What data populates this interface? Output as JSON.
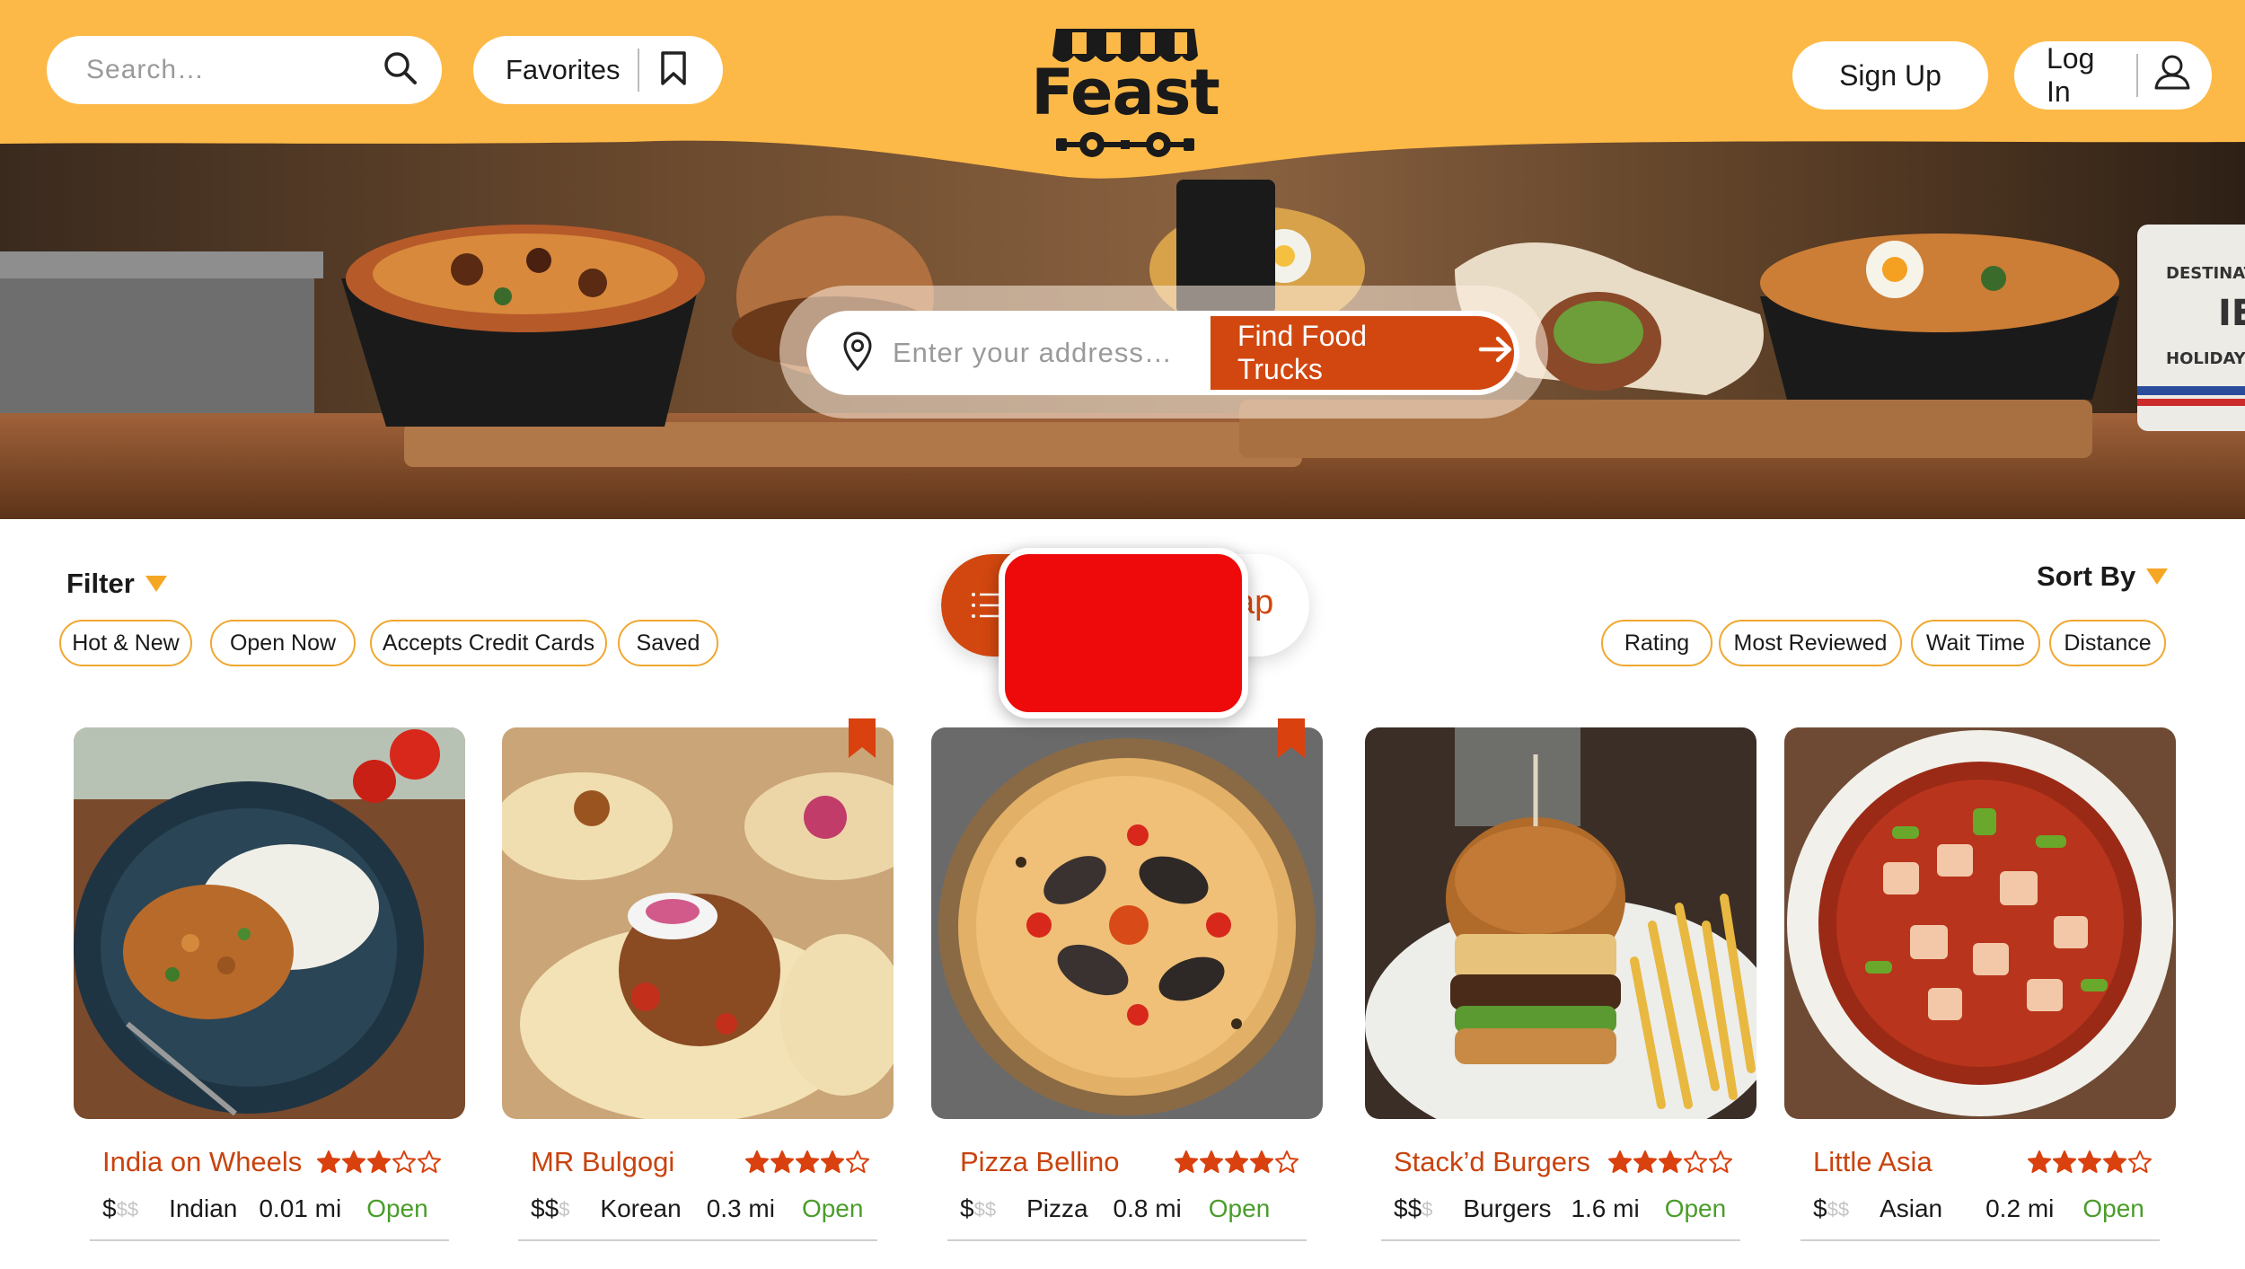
{
  "header": {
    "search_placeholder": "Search…",
    "favorites_label": "Favorites",
    "logo_text": "Feast",
    "signup_label": "Sign Up",
    "login_label": "Log In"
  },
  "hero": {
    "address_placeholder": "Enter your address…",
    "find_button_label": "Find Food Trucks"
  },
  "filter": {
    "title": "Filter",
    "chips": [
      "Hot & New",
      "Open Now",
      "Accepts Credit Cards",
      "Saved"
    ]
  },
  "sort": {
    "title": "Sort By",
    "chips": [
      "Rating",
      "Most Reviewed",
      "Wait Time",
      "Distance"
    ]
  },
  "view_toggle": {
    "list_icon": "list-icon",
    "map_label_visible": "ap"
  },
  "colors": {
    "header_yellow": "#fdb947",
    "accent_orange": "#d2470f",
    "name_orange": "#c8430e",
    "star_orange": "#d9410f",
    "chip_border": "#f0a830",
    "open_green": "#4a9d2a",
    "overlay_red": "#ee0a0a"
  },
  "trucks": [
    {
      "name": "India on Wheels",
      "rating": 3,
      "price_on": "$",
      "price_off": "$$",
      "cuisine": "Indian",
      "distance": "0.01 mi",
      "status": "Open",
      "saved": false
    },
    {
      "name": "MR Bulgogi",
      "rating": 4,
      "price_on": "$$",
      "price_off": "$",
      "cuisine": "Korean",
      "distance": "0.3 mi",
      "status": "Open",
      "saved": true
    },
    {
      "name": "Pizza Bellino",
      "rating": 4,
      "price_on": "$",
      "price_off": "$$",
      "cuisine": "Pizza",
      "distance": "0.8 mi",
      "status": "Open",
      "saved": true
    },
    {
      "name": "Stack’d Burgers",
      "rating": 3,
      "price_on": "$$",
      "price_off": "$",
      "cuisine": "Burgers",
      "distance": "1.6 mi",
      "status": "Open",
      "saved": false
    },
    {
      "name": "Little Asia",
      "rating": 4,
      "price_on": "$",
      "price_off": "$$",
      "cuisine": "Asian",
      "distance": "0.2 mi",
      "status": "Open",
      "saved": false
    }
  ]
}
